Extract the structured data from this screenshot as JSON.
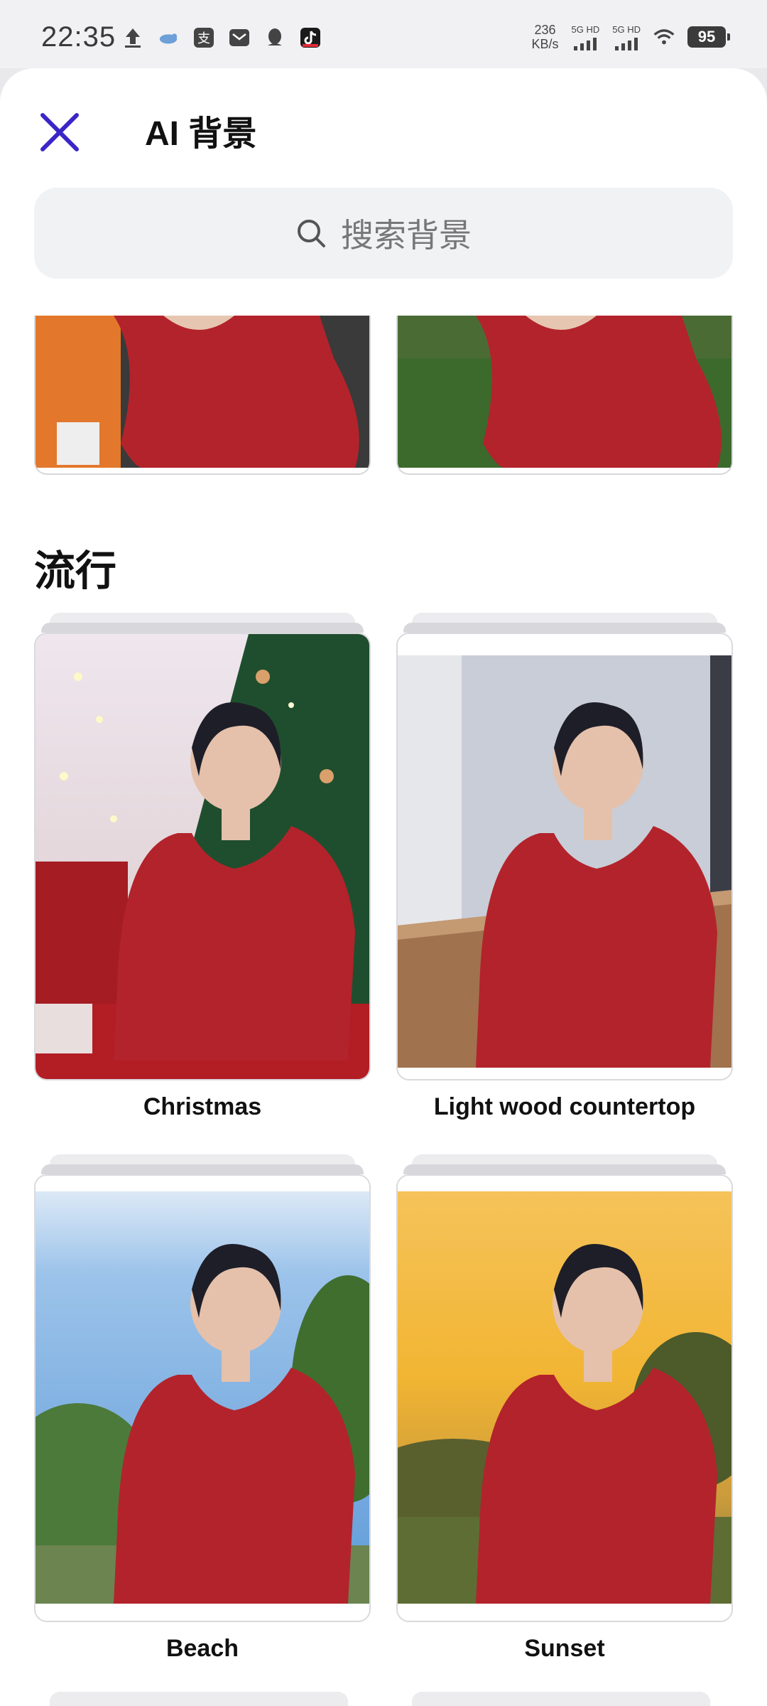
{
  "status_bar": {
    "time": "22:35",
    "speed_value": "236",
    "speed_unit": "KB/s",
    "sim1": "5G HD",
    "sim2": "5G HD",
    "battery": "95"
  },
  "header": {
    "title": "AI 背景"
  },
  "search": {
    "placeholder": "搜索背景"
  },
  "section": {
    "title": "流行"
  },
  "backgrounds": [
    {
      "label": "Christmas"
    },
    {
      "label": "Light wood countertop"
    },
    {
      "label": "Beach"
    },
    {
      "label": "Sunset"
    }
  ],
  "colors": {
    "accent": "#3a25c7",
    "shirt": "#b3232b",
    "search_bg": "#f1f2f4"
  },
  "icons": [
    "upload-icon",
    "bird-icon",
    "alipay-icon",
    "mail-icon",
    "qq-icon",
    "tiktok-icon",
    "wifi-icon",
    "close-icon",
    "search-icon"
  ]
}
